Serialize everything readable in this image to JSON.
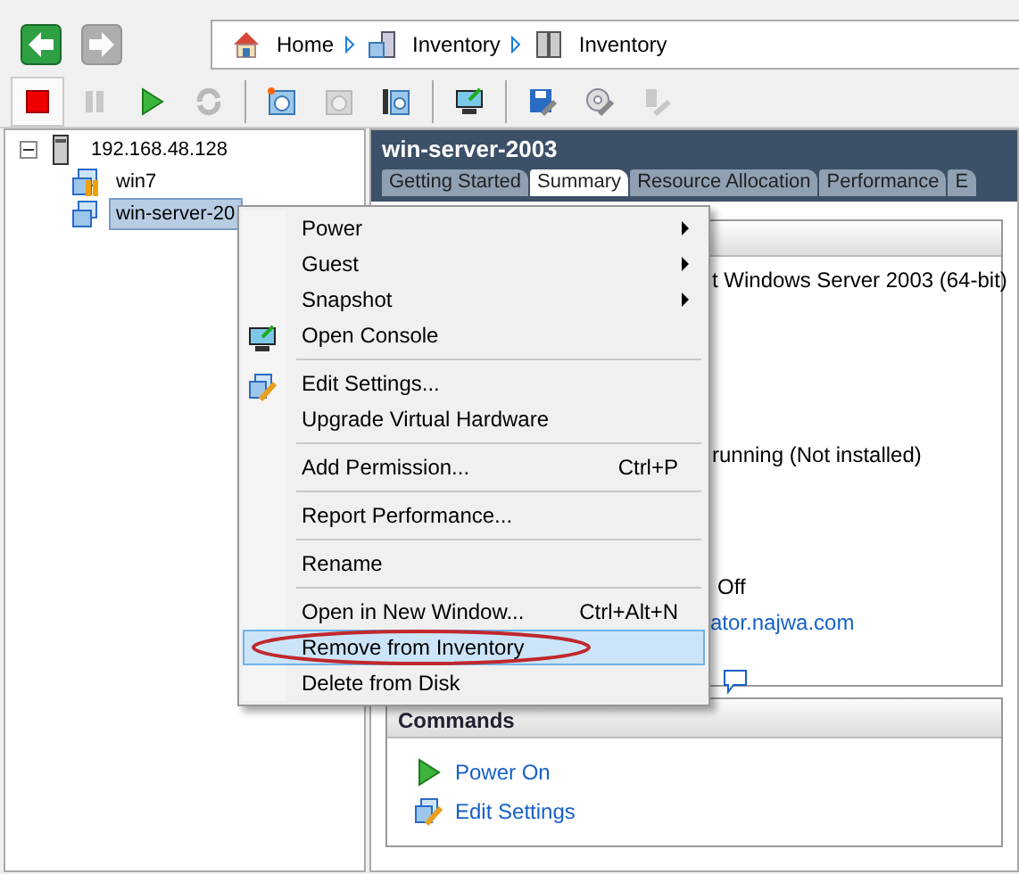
{
  "nav": {
    "back": {
      "disabled": false
    },
    "forward": {
      "disabled": true
    }
  },
  "breadcrumb": [
    {
      "label": "Home",
      "kind": "home"
    },
    {
      "label": "Inventory",
      "kind": "hosts"
    },
    {
      "label": "Inventory",
      "kind": "vms"
    }
  ],
  "toolbar": [
    {
      "kind": "stop",
      "disabled": false,
      "selected": true
    },
    {
      "kind": "pause",
      "disabled": true,
      "selected": false
    },
    {
      "kind": "play",
      "disabled": false,
      "selected": false
    },
    {
      "kind": "reset",
      "disabled": true,
      "selected": false
    },
    {
      "kind": "sep"
    },
    {
      "kind": "snapshot",
      "disabled": false,
      "selected": false
    },
    {
      "kind": "revert",
      "disabled": true,
      "selected": false
    },
    {
      "kind": "manager",
      "disabled": false,
      "selected": false
    },
    {
      "kind": "sep"
    },
    {
      "kind": "console",
      "disabled": false,
      "selected": false
    },
    {
      "kind": "sep"
    },
    {
      "kind": "floppy",
      "disabled": false,
      "selected": false
    },
    {
      "kind": "cd",
      "disabled": false,
      "selected": false
    },
    {
      "kind": "usb",
      "disabled": true,
      "selected": false
    }
  ],
  "tree": [
    {
      "label": "192.168.48.128",
      "kind": "host",
      "expanded": true,
      "selected": false,
      "children": [
        {
          "label": "win7",
          "kind": "vm-paused",
          "selected": false
        },
        {
          "label": "win-server-20",
          "kind": "vm",
          "selected": true
        }
      ]
    }
  ],
  "panel": {
    "title": "win-server-2003",
    "tabs": [
      {
        "label": "Getting Started",
        "selected": false
      },
      {
        "label": "Summary",
        "selected": true
      },
      {
        "label": "Resource Allocation",
        "selected": false
      },
      {
        "label": "Performance",
        "selected": false
      },
      {
        "label": "E",
        "selected": false
      }
    ],
    "summary_lines": [
      {
        "kind": "text",
        "text": "t Windows Server 2003 (64-bit)"
      },
      {
        "kind": "text",
        "text": "running (Not installed)"
      },
      {
        "kind": "text",
        "text": "Off"
      },
      {
        "kind": "link",
        "text": "ator.najwa.com"
      },
      {
        "kind": "note-icon"
      }
    ],
    "commands": {
      "title": "Commands",
      "items": [
        {
          "label": "Power On",
          "kind": "play"
        },
        {
          "label": "Edit Settings",
          "kind": "edit"
        }
      ]
    }
  },
  "context_menu": [
    {
      "label": "Power",
      "submenu": true,
      "selected": false
    },
    {
      "label": "Guest",
      "submenu": true,
      "selected": false
    },
    {
      "label": "Snapshot",
      "submenu": true,
      "selected": false
    },
    {
      "label": "Open Console",
      "kind": "console",
      "selected": false,
      "separator_after": true
    },
    {
      "label": "Edit Settings...",
      "kind": "edit",
      "selected": false
    },
    {
      "label": "Upgrade Virtual Hardware",
      "selected": false,
      "separator_after": true
    },
    {
      "label": "Add Permission...",
      "shortcut": "Ctrl+P",
      "selected": false,
      "separator_after": true
    },
    {
      "label": "Report Performance...",
      "selected": false,
      "separator_after": true
    },
    {
      "label": "Rename",
      "selected": false,
      "separator_after": true
    },
    {
      "label": "Open in New Window...",
      "shortcut": "Ctrl+Alt+N",
      "selected": false
    },
    {
      "label": "Remove from Inventory",
      "selected": true,
      "circled": true
    },
    {
      "label": "Delete from Disk",
      "selected": false
    }
  ]
}
